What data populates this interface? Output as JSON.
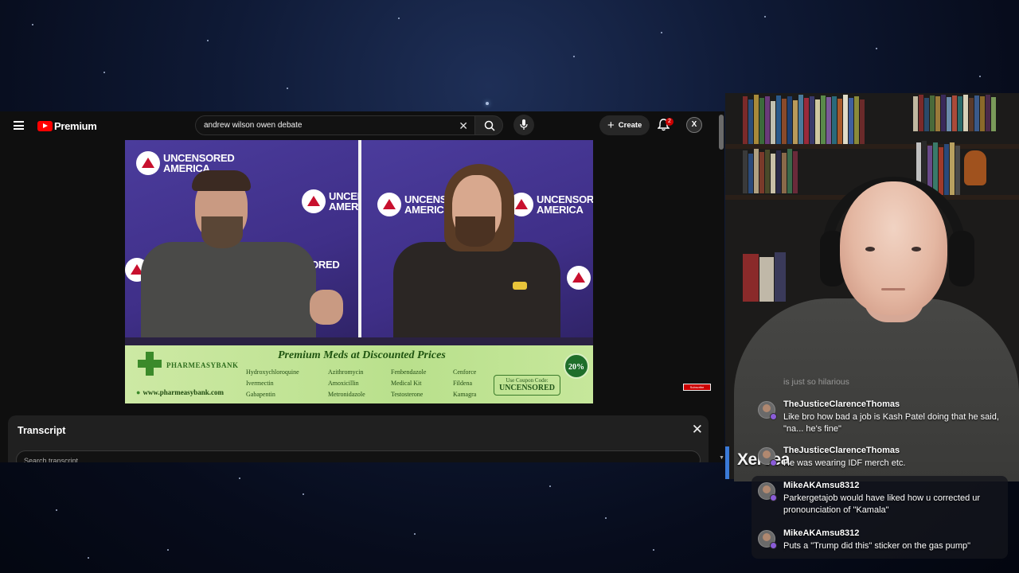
{
  "youtube": {
    "brand": "Premium",
    "search_query": "andrew wilson owen debate",
    "create_label": "Create",
    "notification_count": "2",
    "avatar_letter": "X"
  },
  "video": {
    "backdrop_brand_line1": "UNCENSORED",
    "backdrop_brand_line2": "AMERICA",
    "ad": {
      "title": "Premium Meds at Discounted Prices",
      "brand": "PHARMEASYBANK",
      "url": "www.pharmeasybank.com",
      "columns": [
        [
          "Hydroxychloroquine",
          "Ivermectin",
          "Gabapentin"
        ],
        [
          "Azithromycin",
          "Amoxicillin",
          "Metronidazole"
        ],
        [
          "Fenbendazole",
          "Medical Kit",
          "Testosterone"
        ],
        [
          "Cenforce",
          "Fildena",
          "Kamagra"
        ]
      ],
      "coupon_label": "Use Coupon Code:",
      "coupon_code": "UNCENSORED",
      "badge": "20%"
    },
    "subscribe_mini": "Subscribe"
  },
  "transcript": {
    "title": "Transcript",
    "search_placeholder": "Search transcript"
  },
  "stream": {
    "streamer_name": "Xervea"
  },
  "chat": {
    "faded_line": "is just so hilarious",
    "messages": [
      {
        "user": "TheJusticeClarenceThomas",
        "text": "Like bro how bad a job is Kash Patel doing that he said, \"na... he's fine\""
      },
      {
        "user": "TheJusticeClarenceThomas",
        "text": "He was wearing IDF merch etc."
      },
      {
        "user": "MikeAKAmsu8312",
        "text": "Parkergetajob would have liked how u corrected ur pronounciation of \"Kamala\""
      },
      {
        "user": "MikeAKAmsu8312",
        "text": "Puts a \"Trump did this\" sticker on the gas pump\""
      }
    ]
  },
  "colors": {
    "youtube_red": "#ff0000",
    "subscriber_badge": "#8a5cd8",
    "streamer_accent": "#3a7ad8",
    "backdrop_purple": "#4b3c9c",
    "ad_green": "#b9e08c"
  }
}
